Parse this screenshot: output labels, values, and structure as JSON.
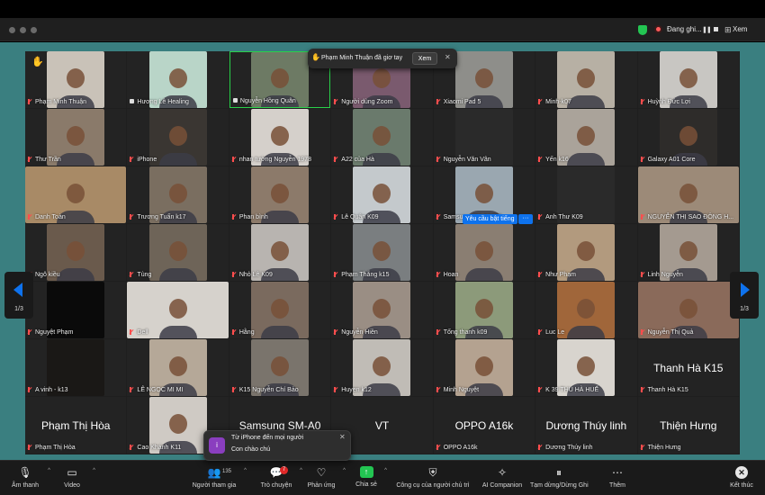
{
  "titlebar": {
    "recording_label": "Đang ghi...",
    "view_label": "Xem"
  },
  "notification": {
    "text": "Phạm Minh Thuận đã giơ tay",
    "button": "Xem"
  },
  "request_unmute": "Yêu cầu bật tiếng",
  "pages": {
    "left": "1/3",
    "right": "1/3"
  },
  "tiles": [
    {
      "label": "Phạm Minh Thuận",
      "tone": "#c9c2b8"
    },
    {
      "label": "Hương Lê Healing",
      "tone": "#b9d5c8"
    },
    {
      "label": "Nguyễn Hồng Quân",
      "tone": "#6d7a64"
    },
    {
      "label": "Người dùng Zoom",
      "tone": "#7a5a6e"
    },
    {
      "label": "Xiaomi Pad 5",
      "tone": "#8e8e8a"
    },
    {
      "label": "Minh-k07",
      "tone": "#b7b0a4"
    },
    {
      "label": "Huỳnh Đức Lợi",
      "tone": "#c8c6c2"
    },
    {
      "label": "Thư Trần",
      "tone": "#8a7a6a"
    },
    {
      "label": "iPhone",
      "tone": "#3a3632"
    },
    {
      "label": "nhan tường Nguyễn 1978",
      "tone": "#d5d0cb"
    },
    {
      "label": "A22 của Hà",
      "tone": "#6a7a6c"
    },
    {
      "label": "Nguyễn Văn Vân",
      "tone": "#2a2a2a"
    },
    {
      "label": "Yến k16",
      "tone": "#aaa39a"
    },
    {
      "label": "Galaxy A01 Core",
      "tone": "#2e2c2a"
    },
    {
      "label": "Danh Toàn",
      "tone": "#a88a66"
    },
    {
      "label": "Trương Tuấn k17",
      "tone": "#7a6e60"
    },
    {
      "label": "Phan bình",
      "tone": "#8c7a6a"
    },
    {
      "label": "Lê Quân K09",
      "tone": "#c4c9cc"
    },
    {
      "label": "Samsung SM-A127F",
      "tone": "#9aa7b0"
    },
    {
      "label": "Anh Thư K09",
      "tone": "#2a2a2a"
    },
    {
      "label": "NGUYỄN THỊ SAO ĐÔNG H...",
      "tone": "#9c8a78"
    },
    {
      "label": "Ngô kiều",
      "tone": "#6a5a4c"
    },
    {
      "label": "Tùng",
      "tone": "#6e6458"
    },
    {
      "label": "Nhỏ Lê K09",
      "tone": "#b8b4b0"
    },
    {
      "label": "Phạm Thắng k15",
      "tone": "#7a7e80"
    },
    {
      "label": "Hoan",
      "tone": "#8a7e72"
    },
    {
      "label": "Như Phạm",
      "tone": "#b29a7e"
    },
    {
      "label": "Linh Nguyễn",
      "tone": "#a49a90"
    },
    {
      "label": "Nguyệt Phạm",
      "tone": "#0a0a0a"
    },
    {
      "label": "Dell",
      "tone": "#d6d2cc"
    },
    {
      "label": "Hằng",
      "tone": "#7a6a5e"
    },
    {
      "label": "Nguyễn Hiền",
      "tone": "#9a8e84"
    },
    {
      "label": "Tống thanh k09",
      "tone": "#8c9a7a"
    },
    {
      "label": "Luc Le",
      "tone": "#a0663a"
    },
    {
      "label": "Nguyễn Thị Quả",
      "tone": "#8a6a5a"
    },
    {
      "label": "A vinh - k13",
      "tone": "#1a1816"
    },
    {
      "label": "LÊ NGỌC MI MI",
      "tone": "#b5a898"
    },
    {
      "label": "K15 Nguyễn Chí Bảo",
      "tone": "#7a746c"
    },
    {
      "label": "Huyen k12",
      "tone": "#c0bcb6"
    },
    {
      "label": "Minh Nguyệt",
      "tone": "#b4a290"
    },
    {
      "label": "K 39 THU HÀ HUẾ",
      "tone": "#d8d4ce"
    },
    {
      "label": "Thanh Hà K15",
      "tone": "#232323",
      "bigname": "Thanh Hà K15"
    },
    {
      "label": "Phạm Thị Hòa",
      "tone": "#232323",
      "bigname": "Phạm Thị Hòa"
    },
    {
      "label": "Cao Khánh K11",
      "tone": "#cfcac4"
    },
    {
      "label": "",
      "tone": "#232323",
      "bigname": "Samsung SM-A0"
    },
    {
      "label": "",
      "tone": "#232323",
      "bigname": "VT"
    },
    {
      "label": "OPPO A16k",
      "tone": "#232323",
      "bigname": "OPPO A16k"
    },
    {
      "label": "Dương Thúy linh",
      "tone": "#232323",
      "bigname": "Dương Thúy linh"
    },
    {
      "label": "Thiện Hưng",
      "tone": "#232323",
      "bigname": "Thiện Hưng"
    }
  ],
  "chat_popup": {
    "avatar": "i",
    "from": "Từ iPhone đến mọi người",
    "message": "Con chào chú"
  },
  "toolbar": {
    "audio": "Âm thanh",
    "video": "Video",
    "participants": "Người tham gia",
    "participants_count": "135",
    "chat": "Trò chuyện",
    "chat_badge": "7",
    "reactions": "Phản ứng",
    "share": "Chia sẻ",
    "host_tools": "Công cụ của người chủ trì",
    "ai": "AI Companion",
    "pause_stop": "Tạm dừng/Dừng Ghi",
    "more": "Thêm",
    "end": "Kết thúc"
  },
  "colors": {
    "accent": "#0e72ed",
    "stage": "#3a7f80",
    "share": "#23c552",
    "muted": "#ff4d4d"
  }
}
